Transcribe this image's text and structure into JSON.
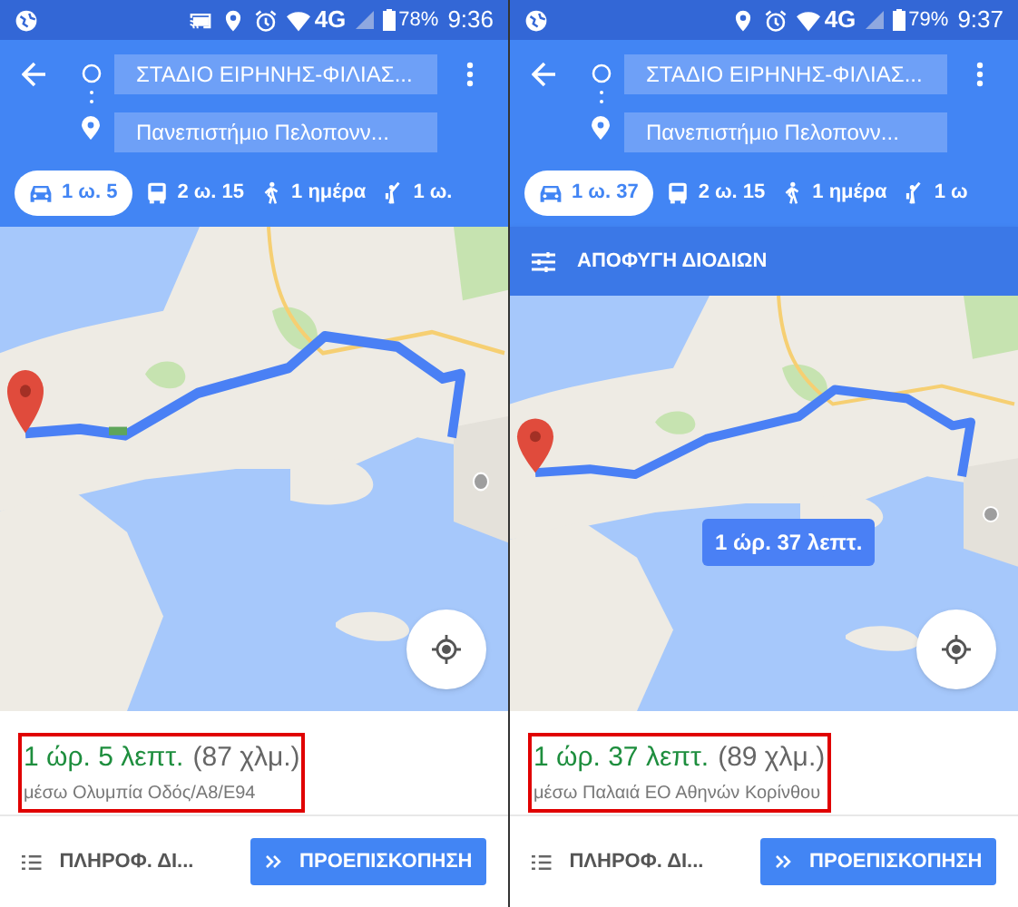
{
  "panels": [
    {
      "status_bar": {
        "icons": [
          {
            "kind": "globe"
          },
          {
            "kind": "cast"
          },
          {
            "kind": "location"
          },
          {
            "kind": "alarm"
          },
          {
            "kind": "wifi"
          }
        ],
        "network": "4G",
        "battery": "78%",
        "time": "9:36"
      },
      "origin": "ΣΤΑΔΙΟ ΕΙΡΗΝΗΣ-ΦΙΛΙΑΣ...",
      "destination": "Πανεπιστήμιο Πελοπονν...",
      "tabs": [
        {
          "kind": "car",
          "label": "1 ω. 5",
          "selected": true
        },
        {
          "kind": "transit",
          "label": "2 ω. 15",
          "selected": false
        },
        {
          "kind": "walk",
          "label": "1 ημέρα",
          "selected": false
        },
        {
          "kind": "ride",
          "label": "1 ω.",
          "selected": false
        }
      ],
      "summary": {
        "duration": "1 ώρ. 5 λεπτ.",
        "distance": "(87 χλμ.)",
        "via": "μέσω Ολυμπία Οδός/Α8/Ε94",
        "highlighted": true
      },
      "footer": {
        "details": "ΠΛΗΡΟΦ. ΔΙ...",
        "preview": "ΠΡΟΕΠΙΣΚΟΠΗΣΗ"
      }
    },
    {
      "status_bar": {
        "icons": [
          {
            "kind": "globe"
          },
          {
            "kind": "location"
          },
          {
            "kind": "alarm"
          },
          {
            "kind": "wifi"
          }
        ],
        "network": "4G",
        "battery": "79%",
        "time": "9:37"
      },
      "origin": "ΣΤΑΔΙΟ ΕΙΡΗΝΗΣ-ΦΙΛΙΑΣ...",
      "destination": "Πανεπιστήμιο Πελοπονν...",
      "tabs": [
        {
          "kind": "car",
          "label": "1 ω. 37",
          "selected": true
        },
        {
          "kind": "transit",
          "label": "2 ω. 15",
          "selected": false
        },
        {
          "kind": "walk",
          "label": "1 ημέρα",
          "selected": false
        },
        {
          "kind": "ride",
          "label": "1 ω",
          "selected": false
        }
      ],
      "toll_bar": {
        "label": "ΑΠΟΦΥΓΗ ΔΙΟΔΙΩΝ"
      },
      "route_callout": "1 ώρ. 37 λεπτ.",
      "summary": {
        "duration": "1 ώρ. 37 λεπτ.",
        "distance": "(89 χλμ.)",
        "via": "μέσω Παλαιά ΕΟ Αθηνών Κορίνθου",
        "highlighted": true
      },
      "footer": {
        "details": "ΠΛΗΡΟΦ. ΔΙ...",
        "preview": "ΠΡΟΕΠΙΣΚΟΠΗΣΗ"
      }
    }
  ]
}
